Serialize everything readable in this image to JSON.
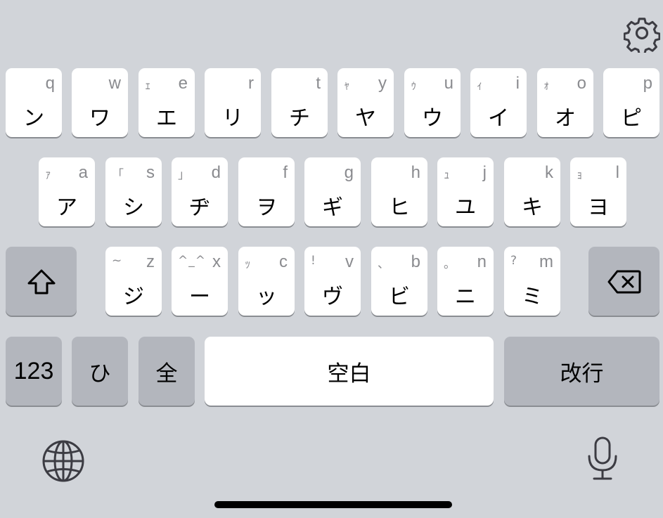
{
  "keyboard": {
    "row1": [
      {
        "main": "ン",
        "small": "",
        "latin": "q"
      },
      {
        "main": "ワ",
        "small": "",
        "latin": "w"
      },
      {
        "main": "エ",
        "small": "ｪ",
        "latin": "e"
      },
      {
        "main": "リ",
        "small": "",
        "latin": "r"
      },
      {
        "main": "チ",
        "small": "",
        "latin": "t"
      },
      {
        "main": "ヤ",
        "small": "ｬ",
        "latin": "y"
      },
      {
        "main": "ウ",
        "small": "ｩ",
        "latin": "u"
      },
      {
        "main": "イ",
        "small": "ｨ",
        "latin": "i"
      },
      {
        "main": "オ",
        "small": "ｫ",
        "latin": "o"
      },
      {
        "main": "ピ",
        "small": "",
        "latin": "p"
      }
    ],
    "row2": [
      {
        "main": "ア",
        "small": "ｧ",
        "latin": "a"
      },
      {
        "main": "シ",
        "small": "「",
        "latin": "s"
      },
      {
        "main": "ヂ",
        "small": "」",
        "latin": "d"
      },
      {
        "main": "ヲ",
        "small": "",
        "latin": "f"
      },
      {
        "main": "ギ",
        "small": "",
        "latin": "g"
      },
      {
        "main": "ヒ",
        "small": "",
        "latin": "h"
      },
      {
        "main": "ユ",
        "small": "ｭ",
        "latin": "j"
      },
      {
        "main": "キ",
        "small": "",
        "latin": "k"
      },
      {
        "main": "ヨ",
        "small": "ｮ",
        "latin": "l"
      }
    ],
    "row3": [
      {
        "main": "ジ",
        "small": "~",
        "latin": "z"
      },
      {
        "main": "ー",
        "small": "^_^",
        "latin": "x"
      },
      {
        "main": "ッ",
        "small": "ｯ",
        "latin": "c"
      },
      {
        "main": "ヴ",
        "small": "!",
        "latin": "v"
      },
      {
        "main": "ビ",
        "small": "、",
        "latin": "b"
      },
      {
        "main": "ニ",
        "small": "。",
        "latin": "n"
      },
      {
        "main": "ミ",
        "small": "?",
        "latin": "m"
      }
    ],
    "bottom": {
      "numbers": "123",
      "hiragana": "ひ",
      "fullwidth": "全",
      "space": "空白",
      "return": "改行"
    },
    "icons": {
      "settings": "gear-icon",
      "shift": "shift-icon",
      "delete": "delete-icon",
      "globe": "globe-icon",
      "mic": "microphone-icon"
    }
  }
}
